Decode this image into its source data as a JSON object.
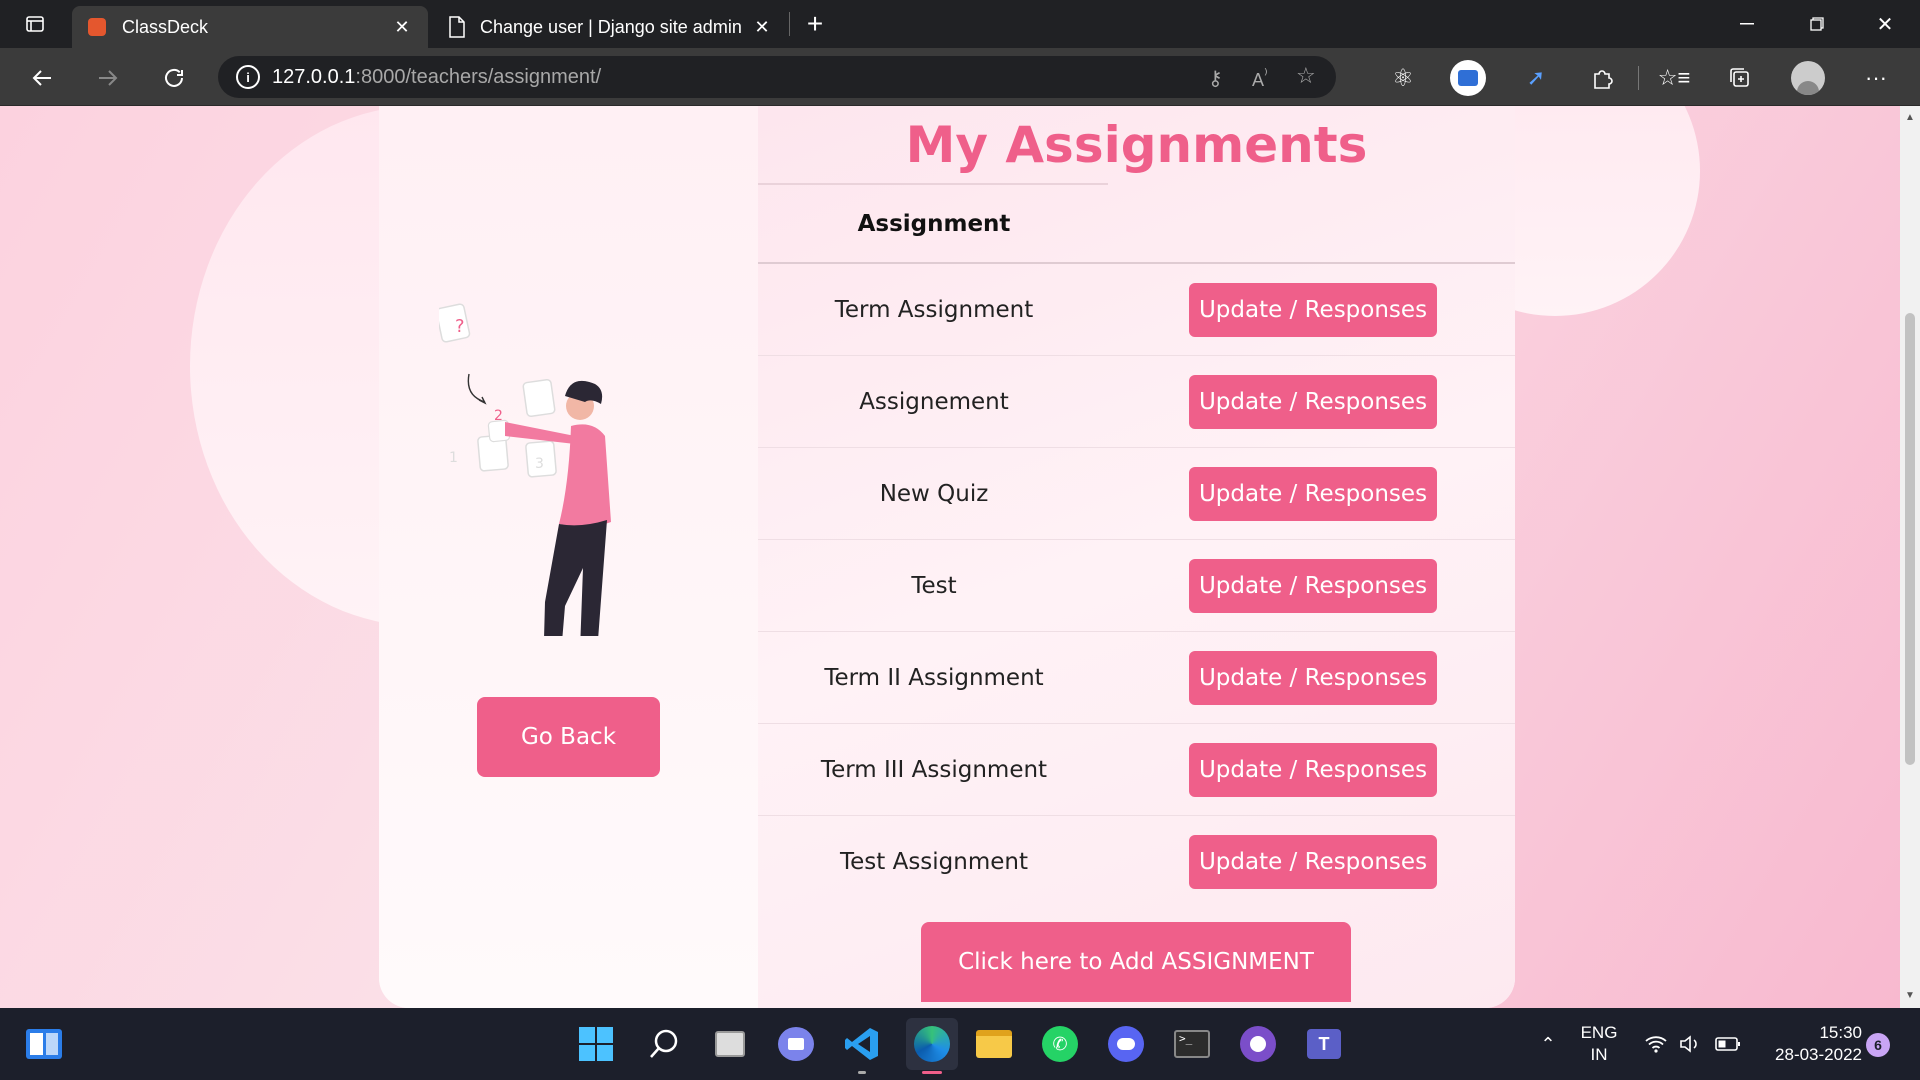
{
  "browser": {
    "tabs": [
      {
        "title": "ClassDeck",
        "active": true,
        "favicon": "classdeck-favicon"
      },
      {
        "title": "Change user | Django site admin",
        "active": false,
        "favicon": "document-icon"
      }
    ],
    "url_host": "127.0.0.1",
    "url_rest": ":8000/teachers/assignment/",
    "toolbar_icons": [
      "back-icon",
      "forward-icon",
      "refresh-icon",
      "info-icon",
      "key-icon",
      "read-aloud-icon",
      "favorite-add-icon",
      "react-devtools-icon",
      "extension-icon",
      "cursor-extension-icon",
      "puzzle-icon",
      "favorites-icon",
      "collections-icon",
      "profile-icon",
      "more-icon"
    ]
  },
  "page": {
    "heading": "My Assignments",
    "table_header": "Assignment",
    "rows": [
      {
        "name": "Term Assignment",
        "action": "Update / Responses"
      },
      {
        "name": "Assignement",
        "action": "Update / Responses"
      },
      {
        "name": "New Quiz",
        "action": "Update / Responses"
      },
      {
        "name": "Test",
        "action": "Update / Responses"
      },
      {
        "name": "Term II Assignment",
        "action": "Update / Responses"
      },
      {
        "name": "Term III Assignment",
        "action": "Update / Responses"
      },
      {
        "name": "Test Assignment",
        "action": "Update / Responses"
      }
    ],
    "go_back": "Go Back",
    "add_assignment": "Click here to Add ASSIGNMENT",
    "illustration_labels": [
      "?",
      "2",
      "1",
      "3"
    ],
    "accent_color": "#ef5f8a"
  },
  "taskbar": {
    "lang_line1": "ENG",
    "lang_line2": "IN",
    "time": "15:30",
    "date": "28-03-2022",
    "notification_count": "6"
  }
}
